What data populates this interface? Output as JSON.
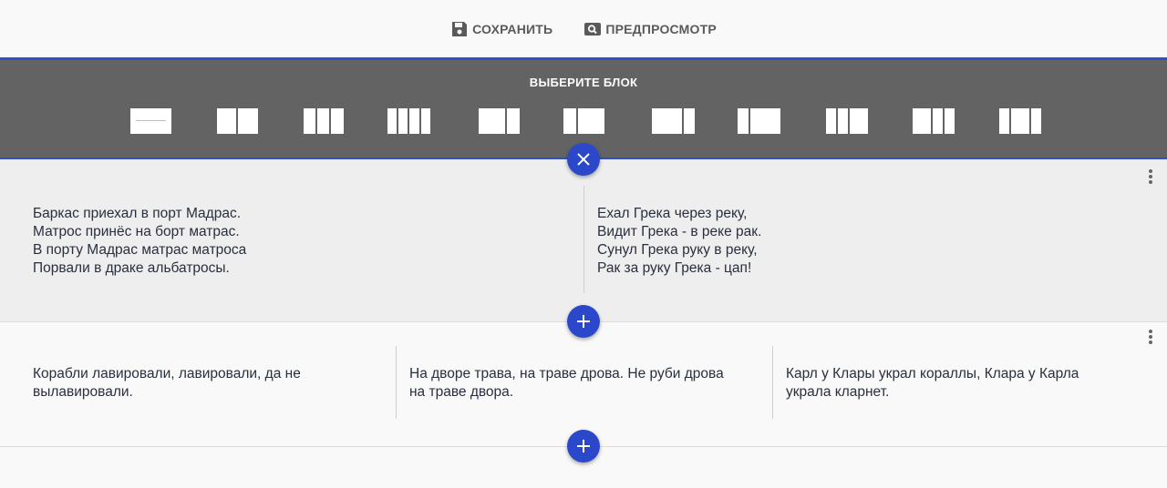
{
  "toolbar": {
    "save_label": "СОХРАНИТЬ",
    "preview_label": "ПРЕДПРОСМОТР"
  },
  "chooser": {
    "title": "ВЫБЕРИТЕ БЛОК",
    "layouts": [
      {
        "name": "layout-full"
      },
      {
        "name": "layout-2-cols"
      },
      {
        "name": "layout-3-cols"
      },
      {
        "name": "layout-4-cols"
      },
      {
        "name": "layout-1-2"
      },
      {
        "name": "layout-2-1"
      },
      {
        "name": "layout-2-1-alt"
      },
      {
        "name": "layout-1-3"
      },
      {
        "name": "layout-1-1-2"
      },
      {
        "name": "layout-2-1-1"
      },
      {
        "name": "layout-1-2-1"
      }
    ]
  },
  "rows": [
    {
      "columns": [
        "Баркас приехал в порт Мадрас.\nМатрос принёс на борт матрас.\nВ порту Мадрас матрас матроса\nПорвали в драке альбатросы.",
        "Ехал Грека через реку,\nВидит Грека - в реке рак.\nСунул Грека руку в реку,\nРак за руку Грека - цап!"
      ]
    },
    {
      "columns": [
        "Корабли лавировали, лавировали, да не\nвылавировали.",
        "На дворе трава, на траве дрова. Не руби дрова\nна траве двора.",
        "Карл у Клары украл кораллы, Клара у Карла\nукрала кларнет."
      ]
    }
  ],
  "colors": {
    "accent": "#2a48c9",
    "panel": "#636363"
  }
}
